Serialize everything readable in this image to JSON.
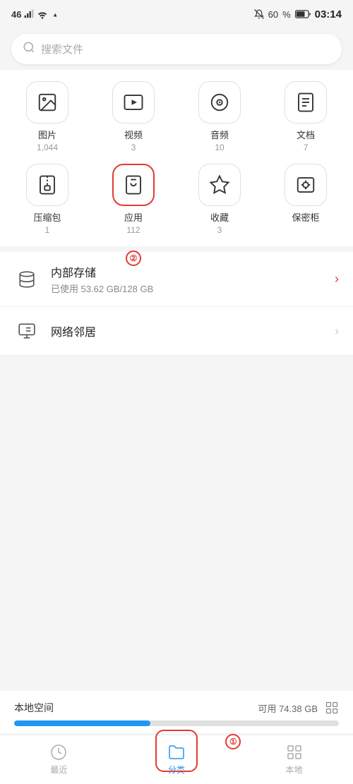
{
  "statusBar": {
    "signal": "46",
    "wifi": "WiFi",
    "time": "03:14",
    "batteryLevel": "60"
  },
  "search": {
    "placeholder": "搜索文件"
  },
  "categories": [
    {
      "id": "images",
      "label": "图片",
      "count": "1,044",
      "iconType": "image",
      "selected": false
    },
    {
      "id": "videos",
      "label": "视频",
      "count": "3",
      "iconType": "video",
      "selected": false
    },
    {
      "id": "audio",
      "label": "音频",
      "count": "10",
      "iconType": "audio",
      "selected": false
    },
    {
      "id": "docs",
      "label": "文档",
      "count": "7",
      "iconType": "doc",
      "selected": false
    },
    {
      "id": "zip",
      "label": "压缩包",
      "count": "1",
      "iconType": "zip",
      "selected": false
    },
    {
      "id": "apps",
      "label": "应用",
      "count": "112",
      "iconType": "app",
      "selected": true
    },
    {
      "id": "favorites",
      "label": "收藏",
      "count": "3",
      "iconType": "star",
      "selected": false
    },
    {
      "id": "safe",
      "label": "保密柜",
      "count": "",
      "iconType": "safe",
      "selected": false
    }
  ],
  "storageItems": [
    {
      "id": "internal",
      "title": "内部存储",
      "subtitle": "已使用 53.62 GB/128 GB",
      "iconType": "storage",
      "chevronColor": "red"
    },
    {
      "id": "network",
      "title": "网络邻居",
      "subtitle": "",
      "iconType": "network",
      "chevronColor": "gray"
    }
  ],
  "bottomStorage": {
    "title": "本地空间",
    "available": "可用 74.38 GB",
    "usedPercent": 42
  },
  "bottomNav": [
    {
      "id": "recent",
      "label": "最近",
      "iconType": "clock",
      "active": false
    },
    {
      "id": "category",
      "label": "分类",
      "iconType": "folder",
      "active": true
    },
    {
      "id": "local",
      "label": "本地",
      "iconType": "grid",
      "active": false
    }
  ],
  "annotations": {
    "circle1": "①",
    "circle2": "②"
  }
}
